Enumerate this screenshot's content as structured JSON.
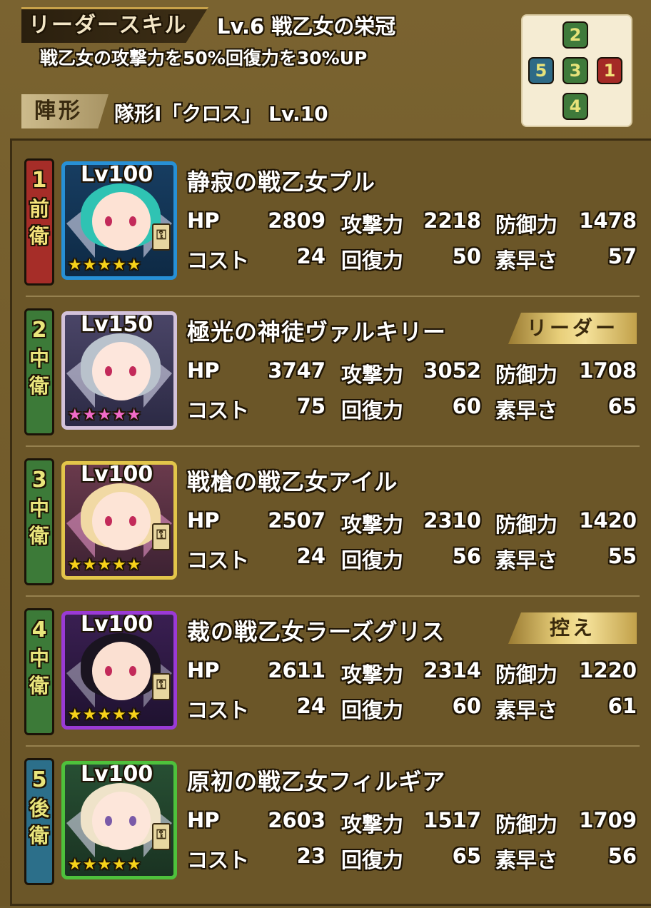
{
  "header": {
    "skill_label": "リーダースキル",
    "skill_title": "Lv.6 戦乙女の栄冠",
    "skill_description": "戦乙女の攻撃力を50%回復力を30%UP",
    "formation_label": "陣形",
    "formation_text": "隊形Ⅰ「クロス」 Lv.10"
  },
  "formation_diagram": {
    "top": "2",
    "left": "5",
    "center": "3",
    "right": "1",
    "bottom": "4"
  },
  "stat_labels": {
    "hp": "HP",
    "attack": "攻撃力",
    "defense": "防御力",
    "cost": "コスト",
    "recovery": "回復力",
    "speed": "素早さ"
  },
  "members": [
    {
      "slot": "1",
      "position": "前衛",
      "level": "Lv100",
      "name": "静寂の戦乙女プル",
      "hp": "2809",
      "attack": "2218",
      "defense": "1478",
      "cost": "24",
      "recovery": "50",
      "speed": "57",
      "tag": "",
      "stars": "★★★★★"
    },
    {
      "slot": "2",
      "position": "中衛",
      "level": "Lv150",
      "name": "極光の神徒ヴァルキリー",
      "hp": "3747",
      "attack": "3052",
      "defense": "1708",
      "cost": "75",
      "recovery": "60",
      "speed": "65",
      "tag": "リーダー",
      "stars": "★★★★★"
    },
    {
      "slot": "3",
      "position": "中衛",
      "level": "Lv100",
      "name": "戦槍の戦乙女アイル",
      "hp": "2507",
      "attack": "2310",
      "defense": "1420",
      "cost": "24",
      "recovery": "56",
      "speed": "55",
      "tag": "",
      "stars": "★★★★★"
    },
    {
      "slot": "4",
      "position": "中衛",
      "level": "Lv100",
      "name": "裁の戦乙女ラーズグリス",
      "hp": "2611",
      "attack": "2314",
      "defense": "1220",
      "cost": "24",
      "recovery": "60",
      "speed": "61",
      "tag": "控え",
      "stars": "★★★★★"
    },
    {
      "slot": "5",
      "position": "後衛",
      "level": "Lv100",
      "name": "原初の戦乙女フィルギア",
      "hp": "2603",
      "attack": "1517",
      "defense": "1709",
      "cost": "23",
      "recovery": "65",
      "speed": "56",
      "tag": "",
      "stars": "★★★★★"
    }
  ]
}
